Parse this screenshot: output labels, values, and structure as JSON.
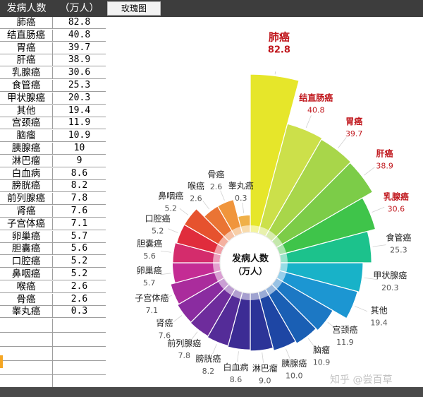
{
  "spreadsheet": {
    "header": {
      "name": "发病人数",
      "value": "（万人）"
    },
    "tab_label": "玫瑰图"
  },
  "watermark": "知乎 @尝百草",
  "chart_data": {
    "type": "rose",
    "center_label_line1": "发病人数",
    "center_label_line2": "（万人）",
    "categories": [
      "肺癌",
      "结直肠癌",
      "胃癌",
      "肝癌",
      "乳腺癌",
      "食管癌",
      "甲状腺癌",
      "其他",
      "宫颈癌",
      "脑瘤",
      "胰腺癌",
      "淋巴瘤",
      "白血病",
      "膀胱癌",
      "前列腺癌",
      "肾癌",
      "子宫体癌",
      "卵巢癌",
      "胆囊癌",
      "口腔癌",
      "鼻咽癌",
      "喉癌",
      "骨癌",
      "睾丸癌"
    ],
    "values": [
      82.8,
      40.8,
      39.7,
      38.9,
      30.6,
      25.3,
      20.3,
      19.4,
      11.9,
      10.9,
      10,
      9,
      8.6,
      8.2,
      7.8,
      7.6,
      7.1,
      5.7,
      5.6,
      5.2,
      5.2,
      2.6,
      2.6,
      0.3
    ],
    "value_labels": [
      "82.8",
      "40.8",
      "39.7",
      "38.9",
      "30.6",
      "25.3",
      "20.3",
      "19.4",
      "11.9",
      "10.9",
      "10.0",
      "9.0",
      "8.6",
      "8.2",
      "7.8",
      "7.6",
      "7.1",
      "5.7",
      "5.6",
      "5.2",
      "5.2",
      "2.6",
      "2.6",
      "0.3"
    ],
    "table_values": [
      "82.8",
      "40.8",
      "39.7",
      "38.9",
      "30.6",
      "25.3",
      "20.3",
      "19.4",
      "11.9",
      "10.9",
      "10",
      "9",
      "8.6",
      "8.2",
      "7.8",
      "7.6",
      "7.1",
      "5.7",
      "5.6",
      "5.2",
      "5.2",
      "2.6",
      "2.6",
      "0.3"
    ],
    "colors": [
      "#e6e62a",
      "#cce04a",
      "#a8d64a",
      "#7ccc48",
      "#3fc44a",
      "#1cc28c",
      "#18b2c8",
      "#1c96d2",
      "#1c78c4",
      "#1a5fb4",
      "#1e46a4",
      "#2c3498",
      "#3c2c94",
      "#542c98",
      "#6e2c9c",
      "#8a2ca0",
      "#aa2c9c",
      "#c42c94",
      "#d42c6c",
      "#e02c3c",
      "#e6522e",
      "#ea7434",
      "#f0953c",
      "#f0b048"
    ],
    "highlight_labels": [
      "肺癌",
      "结直肠癌",
      "胃癌",
      "肝癌",
      "乳腺癌"
    ],
    "highlight_color": "#c0171d"
  }
}
